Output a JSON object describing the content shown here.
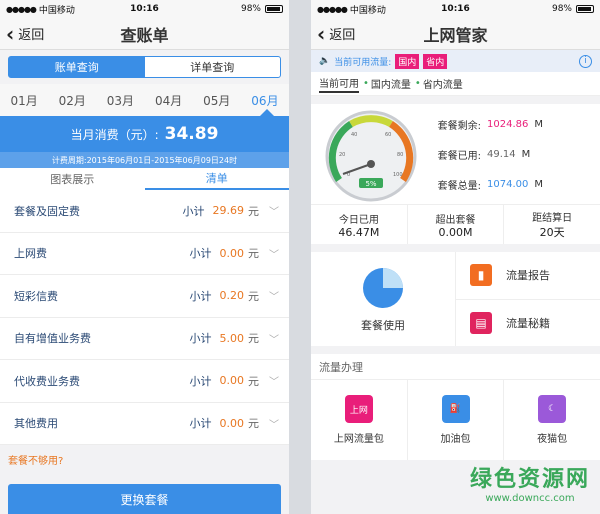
{
  "left": {
    "status": {
      "carrier": "中国移动",
      "time": "10:16",
      "battery": "98%"
    },
    "nav": {
      "back_label": "返回",
      "title": "查账单"
    },
    "segments": [
      "账单查询",
      "详单查询"
    ],
    "months": [
      "01月",
      "02月",
      "03月",
      "04月",
      "05月",
      "06月"
    ],
    "summary": {
      "label": "当月消费（元）:",
      "amount": "34.89",
      "period": "计费周期:2015年06月01日-2015年06月09日24时"
    },
    "view_tabs": [
      "图表展示",
      "清单"
    ],
    "rows": [
      {
        "name": "套餐及固定费",
        "sub": "小计",
        "value": "29.69",
        "unit": "元"
      },
      {
        "name": "上网费",
        "sub": "小计",
        "value": "0.00",
        "unit": "元"
      },
      {
        "name": "短彩信费",
        "sub": "小计",
        "value": "0.20",
        "unit": "元"
      },
      {
        "name": "自有增值业务费",
        "sub": "小计",
        "value": "5.00",
        "unit": "元"
      },
      {
        "name": "代收费业务费",
        "sub": "小计",
        "value": "0.00",
        "unit": "元"
      },
      {
        "name": "其他费用",
        "sub": "小计",
        "value": "0.00",
        "unit": "元"
      }
    ],
    "not_enough": "套餐不够用?",
    "change_button": "更换套餐"
  },
  "right": {
    "status": {
      "carrier": "中国移动",
      "time": "10:16",
      "battery": "98%"
    },
    "nav": {
      "back_label": "返回",
      "title": "上网管家"
    },
    "notice": {
      "text": "当前可用流量:",
      "tags": [
        "国内",
        "省内"
      ]
    },
    "tabs": [
      "当前可用",
      "国内流量",
      "省内流量"
    ],
    "gauge": {
      "percent": "5%",
      "ticks": [
        "0",
        "20",
        "40",
        "60",
        "80",
        "100"
      ]
    },
    "stats": [
      {
        "label": "套餐剩余:",
        "value": "1024.86",
        "unit": "M"
      },
      {
        "label": "套餐已用:",
        "value": "49.14",
        "unit": "M"
      },
      {
        "label": "套餐总量:",
        "value": "1074.00",
        "unit": "M"
      }
    ],
    "triple": [
      {
        "label": "今日已用",
        "value": "46.47M"
      },
      {
        "label": "超出套餐",
        "value": "0.00M"
      },
      {
        "label": "距结算日",
        "value": "20天"
      }
    ],
    "usage_label": "套餐使用",
    "report_label": "流量报告",
    "guide_label": "流量秘籍",
    "section_title": "流量办理",
    "packages": [
      {
        "label": "上网流量包",
        "icon_text": "上网"
      },
      {
        "label": "加油包",
        "icon_text": ""
      },
      {
        "label": "夜猫包",
        "icon_text": ""
      }
    ],
    "watermark": {
      "cn": "绿色资源网",
      "url": "www.downcc.com"
    },
    "colors": {
      "accent": "#3a8ee6",
      "pink": "#e91e7a",
      "orange": "#e87722",
      "green": "#3aa85a"
    }
  }
}
